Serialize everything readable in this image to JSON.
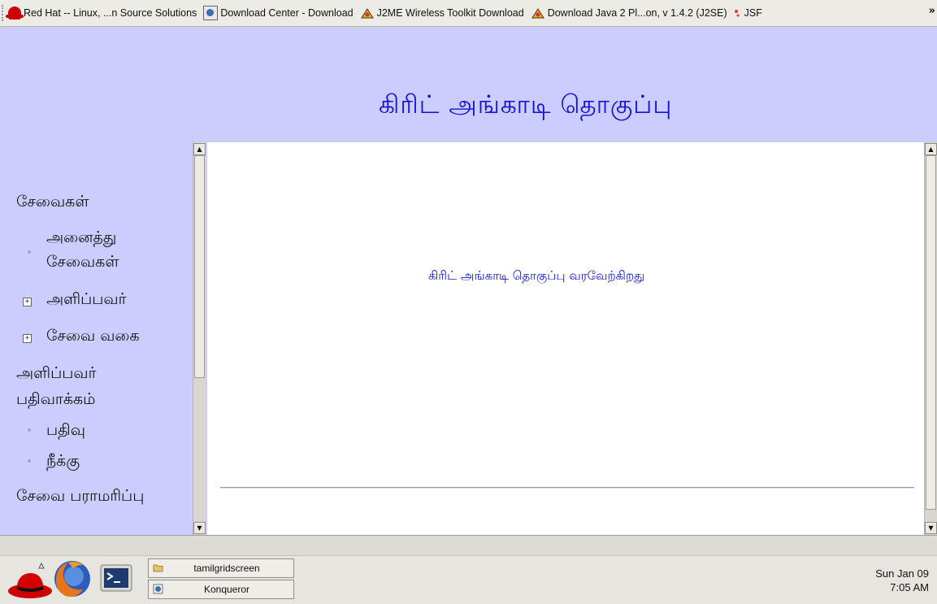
{
  "bookmarks": [
    {
      "label": "Red Hat -- Linux, ...n Source Solutions",
      "icon": "redhat-icon"
    },
    {
      "label": "Download Center - Download",
      "icon": "konqueror-page-icon"
    },
    {
      "label": "J2ME Wireless Toolkit Download",
      "icon": "sun-icon"
    },
    {
      "label": "Download Java 2 Pl...on, v 1.4.2 (J2SE)",
      "icon": "sun-icon"
    },
    {
      "label": "JSF",
      "icon": "java-icon"
    }
  ],
  "bookmarks_more": "»",
  "header": {
    "title": "கிரிட் அங்காடி தொகுப்பு"
  },
  "sidebar": {
    "section1": "சேவைகள்",
    "all_services_line1": "அனைத்து",
    "all_services_line2": "சேவைகள்",
    "provider": "அளிப்பவர்",
    "service_type": "சேவை வகை",
    "provider_reg_line1": "அளிப்பவர்",
    "provider_reg_line2": "பதிவாக்கம்",
    "register": "பதிவு",
    "remove": "நீக்கு",
    "maintenance": "சேவை பராமரிப்பு",
    "expand_symbol": "+"
  },
  "main": {
    "welcome": "கிரிட் அங்காடி தொகுப்பு வரவேற்கிறது"
  },
  "taskbar": {
    "tasks": [
      {
        "label": "tamilgridscreen",
        "icon": "folder-icon"
      },
      {
        "label": "Konqueror",
        "icon": "konqueror-icon"
      }
    ],
    "clock_date": "Sun Jan 09",
    "clock_time": "7:05 AM"
  },
  "colors": {
    "banner_bg": "#ccccff",
    "title_blue": "#1212dd"
  }
}
